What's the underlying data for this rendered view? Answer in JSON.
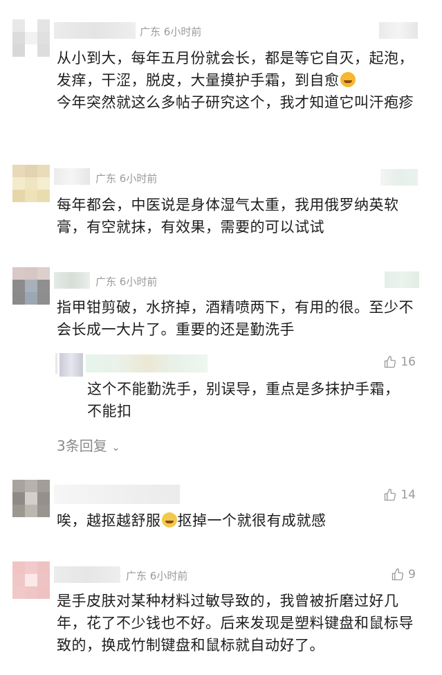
{
  "comments": [
    {
      "location": "广东",
      "time": "6小时前",
      "text": "从小到大，每年五月份就会长，都是等它自灭，起泡，发痒，干涩，脱皮，大量摸护手霜，到自愈",
      "text2": "今年突然就这么多帖子研究这个，我才知道它叫汗疱疹",
      "emoji": "persevering-face-emoji"
    },
    {
      "location": "广东",
      "time": "6小时前",
      "text": "每年都会，中医说是身体湿气太重，我用俄罗纳英软膏，有空就抹，有效果，需要的可以试试"
    },
    {
      "location": "广东",
      "time": "6小时前",
      "text": "指甲钳剪破，水挤掉，酒精喷两下，有用的很。至少不会长成一大片了。重要的还是勤洗手",
      "reply": {
        "likes": "16",
        "text": "这个不能勤洗手，别误导，重点是多抹护手霜，不能扣"
      },
      "replies_link": "3条回复"
    },
    {
      "likes": "14",
      "text1": "唉，越抠越舒服",
      "text2": "抠掉一个就很有成就感",
      "emoji": "crying-face-emoji"
    },
    {
      "location": "广东",
      "time": "6小时前",
      "likes": "9",
      "text": "是手皮肤对某种材料过敏导致的，我曾被折磨过好几年，花了不少钱也不好。后来发现是塑料键盘和鼠标导致的，换成竹制键盘和鼠标就自动好了。"
    }
  ]
}
